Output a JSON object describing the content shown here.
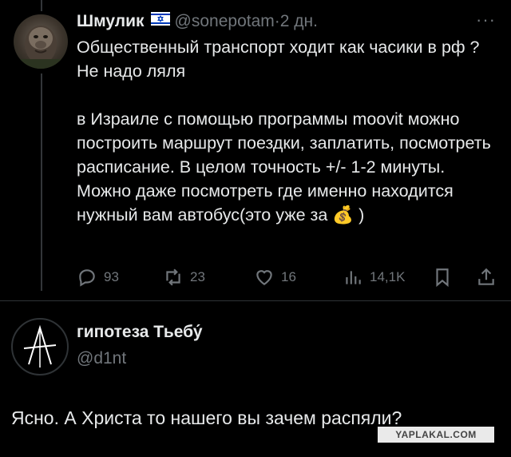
{
  "tweet1": {
    "author_name": "Шмулик",
    "flag_icon": "israel-flag-icon",
    "handle": "@sonepotam",
    "separator": "·",
    "time": "2 дн.",
    "more_label": "···",
    "text_line1": "Общественный транспорт ходит как часики в рф ? Не надо ляля",
    "text_line2_before_emoji": "в Израиле с помощью программы moovit можно построить маршрут поездки, заплатить, посмотреть расписание. В целом точность +/- 1-2 минуты. Можно даже посмотреть где именно находится нужный вам автобус(это уже за ",
    "emoji": "💰",
    "text_line2_after_emoji": " )",
    "actions": {
      "replies": "93",
      "reposts": "23",
      "likes": "16",
      "views": "14,1K"
    }
  },
  "tweet2": {
    "author_name": "гипотеза Тьебу́",
    "handle": "@d1nt",
    "text": "Ясно. А Христа то нашего вы зачем распяли?"
  },
  "watermark": "YAPLAKAL.COM",
  "colors": {
    "background": "#000000",
    "text": "#e7e9ea",
    "muted": "#71767b",
    "divider": "#2f3336"
  }
}
